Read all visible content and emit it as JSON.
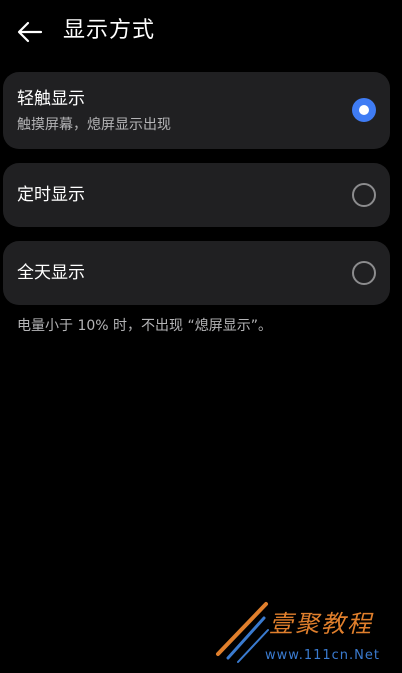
{
  "header": {
    "back_icon": "arrow-left-icon",
    "title": "显示方式"
  },
  "options": [
    {
      "title": "轻触显示",
      "subtitle": "触摸屏幕，熄屏显示出现",
      "selected": true
    },
    {
      "title": "定时显示",
      "selected": false
    },
    {
      "title": "全天显示",
      "selected": false
    }
  ],
  "note": "电量小于 10% 时，不出现 “熄屏显示”。",
  "watermark": {
    "name": "壹聚教程",
    "url": "www.111cn.Net"
  },
  "colors": {
    "background": "#000000",
    "card": "#202022",
    "accent": "#3f7cf4",
    "subtext": "#b4b4b6"
  }
}
